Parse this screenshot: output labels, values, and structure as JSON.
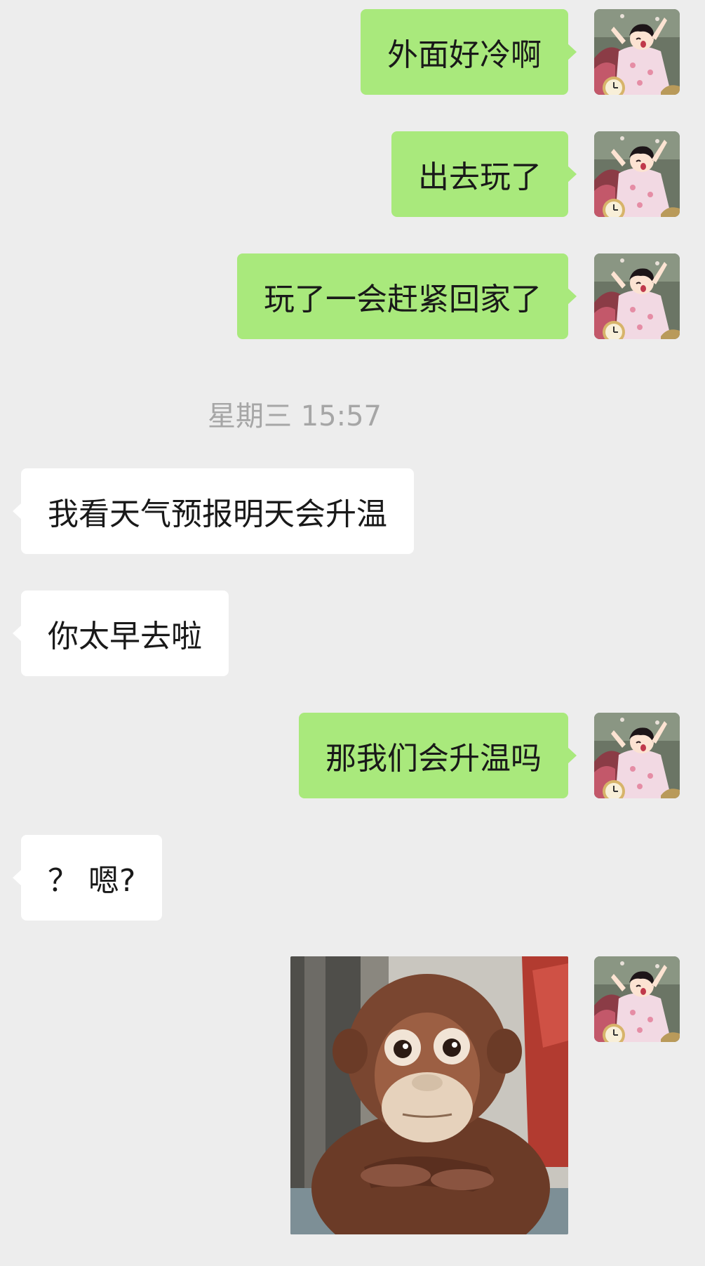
{
  "messages": [
    {
      "from": "me",
      "text": "外面好冷啊"
    },
    {
      "from": "me",
      "text": "出去玩了"
    },
    {
      "from": "me",
      "text": "玩了一会赶紧回家了"
    },
    {
      "from": "them",
      "text": "我看天气预报明天会升温"
    },
    {
      "from": "them",
      "text": "你太早去啦"
    },
    {
      "from": "me",
      "text": "那我们会升温吗"
    },
    {
      "from": "them",
      "text": "？ 嗯?"
    }
  ],
  "timestamp": "星期三 15:57",
  "avatar": {
    "icon": "cartoon-girl-avatar"
  },
  "sticker": {
    "icon": "monkey-plush-sticker"
  },
  "colors": {
    "outgoing_bubble": "#a9e97c",
    "incoming_bubble": "#ffffff",
    "background": "#ededed",
    "timestamp_text": "#a6a6a6"
  }
}
